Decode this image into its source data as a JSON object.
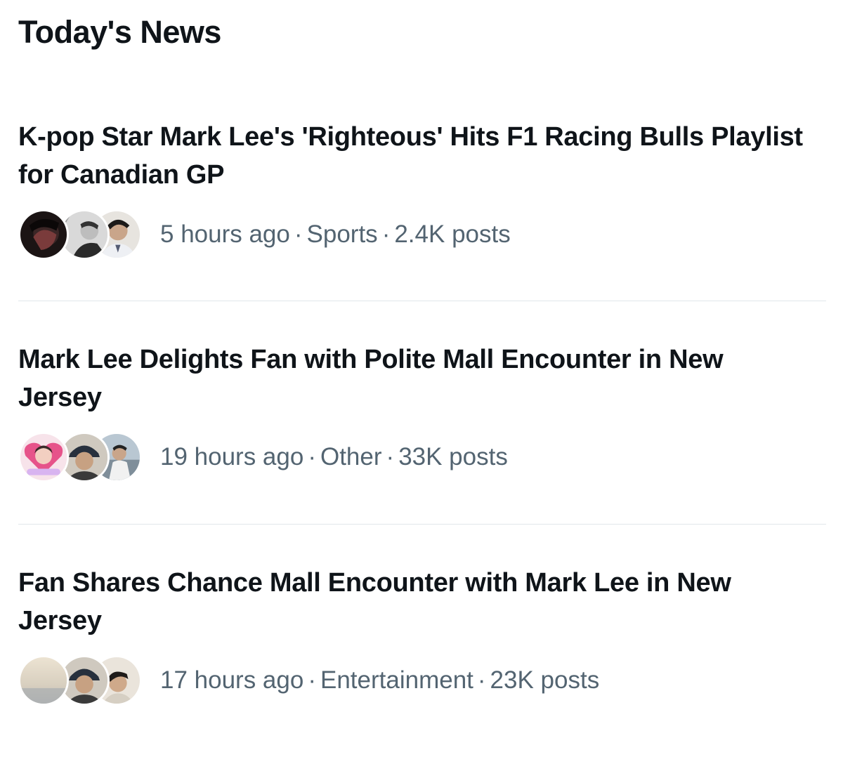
{
  "section": {
    "title": "Today's News"
  },
  "news": [
    {
      "headline": "K-pop Star Mark Lee's 'Righteous' Hits F1 Racing Bulls Playlist for Canadian GP",
      "time": "5 hours ago",
      "category": "Sports",
      "posts": "2.4K posts"
    },
    {
      "headline": "Mark Lee Delights Fan with Polite Mall Encounter in New Jersey",
      "time": "19 hours ago",
      "category": "Other",
      "posts": "33K posts"
    },
    {
      "headline": "Fan Shares Chance Mall Encounter with Mark Lee in New Jersey",
      "time": "17 hours ago",
      "category": "Entertainment",
      "posts": "23K posts"
    }
  ],
  "separator": "·",
  "colors": {
    "text_primary": "#0f1419",
    "text_secondary": "#536471",
    "divider": "#e1e6ea",
    "background": "#ffffff"
  }
}
